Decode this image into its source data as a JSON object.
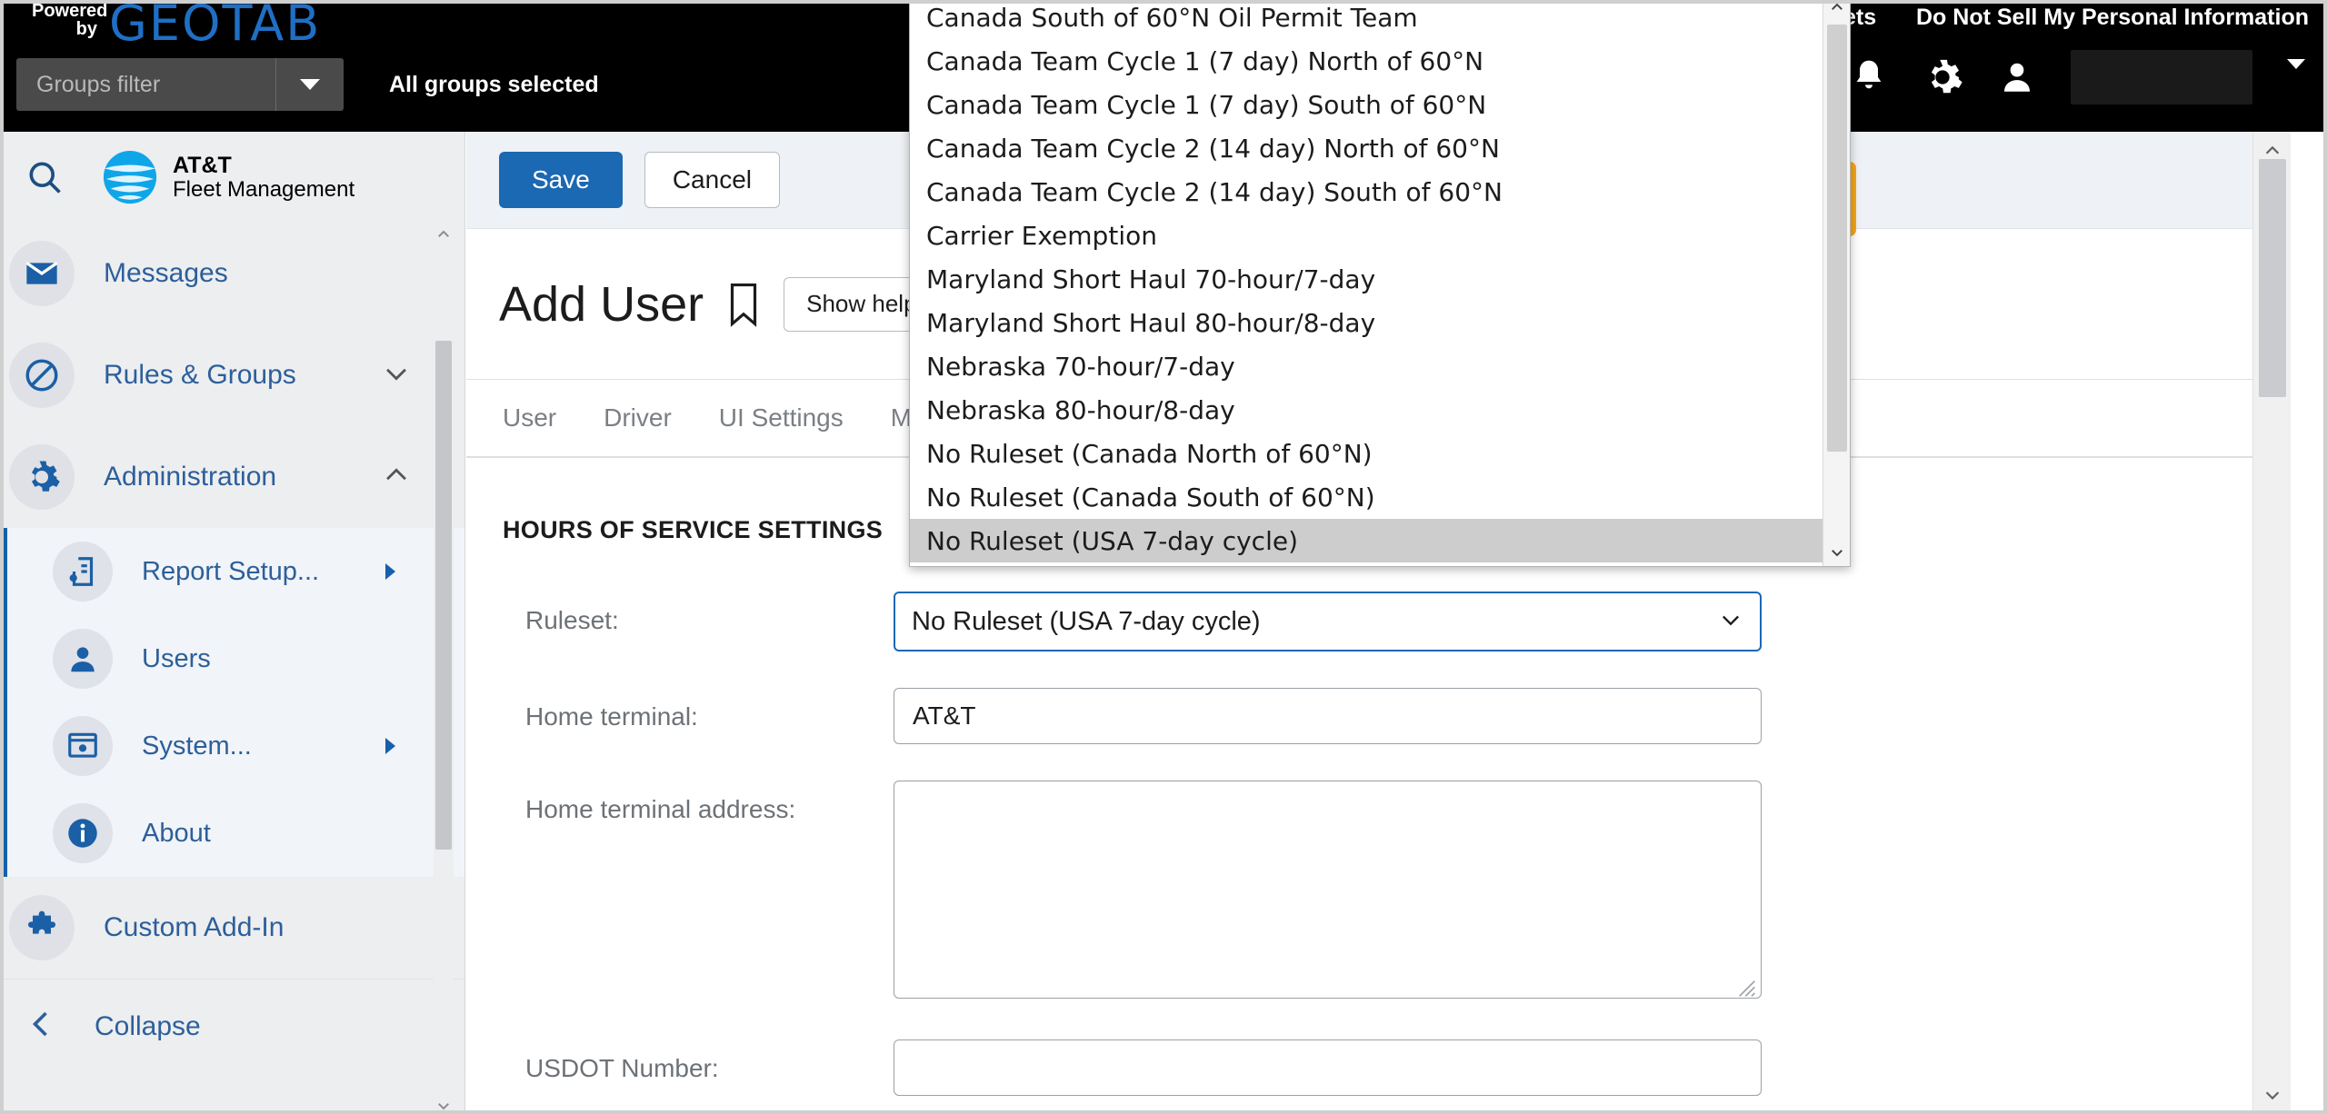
{
  "topbar": {
    "powered": "Powered",
    "by": "by",
    "brand": "GEOTAB",
    "groups_filter_placeholder": "Groups filter",
    "all_groups_selected": "All groups selected",
    "tickets_partial": "ets",
    "do_not_sell": "Do Not Sell My Personal Information",
    "icons": {
      "bell": "bell-icon",
      "gear": "gear-icon",
      "user": "user-icon",
      "caret": "chevron-down-icon"
    }
  },
  "sidebar": {
    "search_icon": "search-icon",
    "logo_line1": "AT&T",
    "logo_line2": "Fleet Management",
    "items": [
      {
        "label": "Messages",
        "icon": "envelope-icon",
        "chevron": ""
      },
      {
        "label": "Rules & Groups",
        "icon": "prohibited-icon",
        "chevron": "v"
      },
      {
        "label": "Administration",
        "icon": "gear-icon",
        "chevron": "^"
      }
    ],
    "sub_items": [
      {
        "label": "Report Setup...",
        "icon": "report-setup-icon",
        "has_arrow": true
      },
      {
        "label": "Users",
        "icon": "user-icon",
        "has_arrow": false
      },
      {
        "label": "System...",
        "icon": "system-icon",
        "has_arrow": true
      },
      {
        "label": "About",
        "icon": "info-icon",
        "has_arrow": false
      }
    ],
    "addin": {
      "label": "Custom Add-In",
      "icon": "puzzle-icon"
    },
    "collapse": {
      "label": "Collapse",
      "icon": "chevron-left-icon"
    }
  },
  "main": {
    "save_label": "Save",
    "cancel_label": "Cancel",
    "page_title": "Add User",
    "bookmark_icon": "bookmark-icon",
    "show_help_label": "Show help",
    "tabs": [
      {
        "label": "User"
      },
      {
        "label": "Driver"
      },
      {
        "label": "UI Settings"
      },
      {
        "label": "Map S"
      }
    ],
    "section_title": "HOURS OF SERVICE SETTINGS",
    "fields": {
      "ruleset_label": "Ruleset:",
      "ruleset_value": "No Ruleset (USA 7-day cycle)",
      "home_terminal_label": "Home terminal:",
      "home_terminal_value": "AT&T",
      "home_terminal_address_label": "Home terminal address:",
      "home_terminal_address_value": "",
      "usdot_label": "USDOT Number:",
      "usdot_value": ""
    }
  },
  "dropdown": {
    "selected": "No Ruleset (USA 7-day cycle)",
    "options": [
      "Canada South of 60°N Oil Permit Team",
      "Canada Team Cycle 1 (7 day) North of 60°N",
      "Canada Team Cycle 1 (7 day) South of 60°N",
      "Canada Team Cycle 2 (14 day) North of 60°N",
      "Canada Team Cycle 2 (14 day) South of 60°N",
      "Carrier Exemption",
      "Maryland Short Haul 70-hour/7-day",
      "Maryland Short Haul 80-hour/8-day",
      "Nebraska 70-hour/7-day",
      "Nebraska 80-hour/8-day",
      "No Ruleset (Canada North of 60°N)",
      "No Ruleset (Canada South of 60°N)",
      "No Ruleset (USA 7-day cycle)"
    ]
  },
  "colors": {
    "accent_blue": "#1b68b3",
    "brand_blue": "#1f6fc4",
    "highlight_orange": "#f5a616",
    "topbar_black": "#000000"
  }
}
